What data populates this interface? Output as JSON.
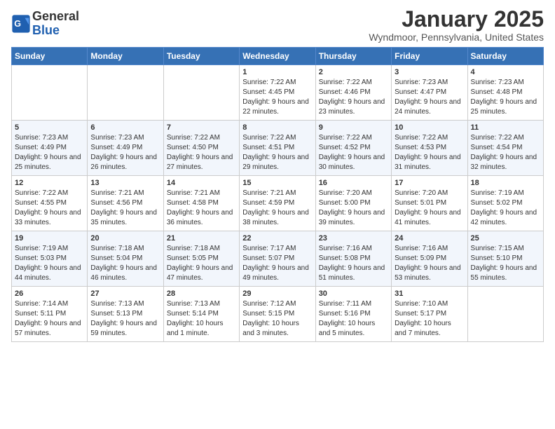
{
  "header": {
    "logo_line1": "General",
    "logo_line2": "Blue",
    "month": "January 2025",
    "location": "Wyndmoor, Pennsylvania, United States"
  },
  "weekdays": [
    "Sunday",
    "Monday",
    "Tuesday",
    "Wednesday",
    "Thursday",
    "Friday",
    "Saturday"
  ],
  "weeks": [
    [
      {
        "day": "",
        "sunrise": "",
        "sunset": "",
        "daylight": ""
      },
      {
        "day": "",
        "sunrise": "",
        "sunset": "",
        "daylight": ""
      },
      {
        "day": "",
        "sunrise": "",
        "sunset": "",
        "daylight": ""
      },
      {
        "day": "1",
        "sunrise": "Sunrise: 7:22 AM",
        "sunset": "Sunset: 4:45 PM",
        "daylight": "Daylight: 9 hours and 22 minutes."
      },
      {
        "day": "2",
        "sunrise": "Sunrise: 7:22 AM",
        "sunset": "Sunset: 4:46 PM",
        "daylight": "Daylight: 9 hours and 23 minutes."
      },
      {
        "day": "3",
        "sunrise": "Sunrise: 7:23 AM",
        "sunset": "Sunset: 4:47 PM",
        "daylight": "Daylight: 9 hours and 24 minutes."
      },
      {
        "day": "4",
        "sunrise": "Sunrise: 7:23 AM",
        "sunset": "Sunset: 4:48 PM",
        "daylight": "Daylight: 9 hours and 25 minutes."
      }
    ],
    [
      {
        "day": "5",
        "sunrise": "Sunrise: 7:23 AM",
        "sunset": "Sunset: 4:49 PM",
        "daylight": "Daylight: 9 hours and 25 minutes."
      },
      {
        "day": "6",
        "sunrise": "Sunrise: 7:23 AM",
        "sunset": "Sunset: 4:49 PM",
        "daylight": "Daylight: 9 hours and 26 minutes."
      },
      {
        "day": "7",
        "sunrise": "Sunrise: 7:22 AM",
        "sunset": "Sunset: 4:50 PM",
        "daylight": "Daylight: 9 hours and 27 minutes."
      },
      {
        "day": "8",
        "sunrise": "Sunrise: 7:22 AM",
        "sunset": "Sunset: 4:51 PM",
        "daylight": "Daylight: 9 hours and 29 minutes."
      },
      {
        "day": "9",
        "sunrise": "Sunrise: 7:22 AM",
        "sunset": "Sunset: 4:52 PM",
        "daylight": "Daylight: 9 hours and 30 minutes."
      },
      {
        "day": "10",
        "sunrise": "Sunrise: 7:22 AM",
        "sunset": "Sunset: 4:53 PM",
        "daylight": "Daylight: 9 hours and 31 minutes."
      },
      {
        "day": "11",
        "sunrise": "Sunrise: 7:22 AM",
        "sunset": "Sunset: 4:54 PM",
        "daylight": "Daylight: 9 hours and 32 minutes."
      }
    ],
    [
      {
        "day": "12",
        "sunrise": "Sunrise: 7:22 AM",
        "sunset": "Sunset: 4:55 PM",
        "daylight": "Daylight: 9 hours and 33 minutes."
      },
      {
        "day": "13",
        "sunrise": "Sunrise: 7:21 AM",
        "sunset": "Sunset: 4:56 PM",
        "daylight": "Daylight: 9 hours and 35 minutes."
      },
      {
        "day": "14",
        "sunrise": "Sunrise: 7:21 AM",
        "sunset": "Sunset: 4:58 PM",
        "daylight": "Daylight: 9 hours and 36 minutes."
      },
      {
        "day": "15",
        "sunrise": "Sunrise: 7:21 AM",
        "sunset": "Sunset: 4:59 PM",
        "daylight": "Daylight: 9 hours and 38 minutes."
      },
      {
        "day": "16",
        "sunrise": "Sunrise: 7:20 AM",
        "sunset": "Sunset: 5:00 PM",
        "daylight": "Daylight: 9 hours and 39 minutes."
      },
      {
        "day": "17",
        "sunrise": "Sunrise: 7:20 AM",
        "sunset": "Sunset: 5:01 PM",
        "daylight": "Daylight: 9 hours and 41 minutes."
      },
      {
        "day": "18",
        "sunrise": "Sunrise: 7:19 AM",
        "sunset": "Sunset: 5:02 PM",
        "daylight": "Daylight: 9 hours and 42 minutes."
      }
    ],
    [
      {
        "day": "19",
        "sunrise": "Sunrise: 7:19 AM",
        "sunset": "Sunset: 5:03 PM",
        "daylight": "Daylight: 9 hours and 44 minutes."
      },
      {
        "day": "20",
        "sunrise": "Sunrise: 7:18 AM",
        "sunset": "Sunset: 5:04 PM",
        "daylight": "Daylight: 9 hours and 46 minutes."
      },
      {
        "day": "21",
        "sunrise": "Sunrise: 7:18 AM",
        "sunset": "Sunset: 5:05 PM",
        "daylight": "Daylight: 9 hours and 47 minutes."
      },
      {
        "day": "22",
        "sunrise": "Sunrise: 7:17 AM",
        "sunset": "Sunset: 5:07 PM",
        "daylight": "Daylight: 9 hours and 49 minutes."
      },
      {
        "day": "23",
        "sunrise": "Sunrise: 7:16 AM",
        "sunset": "Sunset: 5:08 PM",
        "daylight": "Daylight: 9 hours and 51 minutes."
      },
      {
        "day": "24",
        "sunrise": "Sunrise: 7:16 AM",
        "sunset": "Sunset: 5:09 PM",
        "daylight": "Daylight: 9 hours and 53 minutes."
      },
      {
        "day": "25",
        "sunrise": "Sunrise: 7:15 AM",
        "sunset": "Sunset: 5:10 PM",
        "daylight": "Daylight: 9 hours and 55 minutes."
      }
    ],
    [
      {
        "day": "26",
        "sunrise": "Sunrise: 7:14 AM",
        "sunset": "Sunset: 5:11 PM",
        "daylight": "Daylight: 9 hours and 57 minutes."
      },
      {
        "day": "27",
        "sunrise": "Sunrise: 7:13 AM",
        "sunset": "Sunset: 5:13 PM",
        "daylight": "Daylight: 9 hours and 59 minutes."
      },
      {
        "day": "28",
        "sunrise": "Sunrise: 7:13 AM",
        "sunset": "Sunset: 5:14 PM",
        "daylight": "Daylight: 10 hours and 1 minute."
      },
      {
        "day": "29",
        "sunrise": "Sunrise: 7:12 AM",
        "sunset": "Sunset: 5:15 PM",
        "daylight": "Daylight: 10 hours and 3 minutes."
      },
      {
        "day": "30",
        "sunrise": "Sunrise: 7:11 AM",
        "sunset": "Sunset: 5:16 PM",
        "daylight": "Daylight: 10 hours and 5 minutes."
      },
      {
        "day": "31",
        "sunrise": "Sunrise: 7:10 AM",
        "sunset": "Sunset: 5:17 PM",
        "daylight": "Daylight: 10 hours and 7 minutes."
      },
      {
        "day": "",
        "sunrise": "",
        "sunset": "",
        "daylight": ""
      }
    ]
  ]
}
